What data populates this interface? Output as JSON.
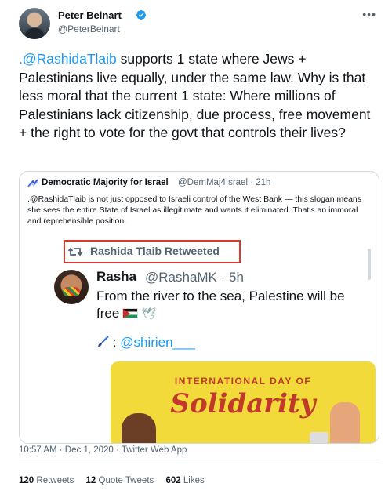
{
  "author": {
    "name": "Peter Beinart",
    "handle": "@PeterBeinart",
    "more": "•••"
  },
  "tweet": {
    "mention": ".@RashidaTlaib",
    "text": " supports 1 state where Jews + Palestinians live equally, under the same law. Why is that less moral that the current 1 state: Where millions of Palestinians lack citizenship, due process, free movement + the right to vote for the govt that controls their lives?"
  },
  "quote": {
    "name": "Democratic Majority for Israel",
    "meta": "@DemMaj4Israel · 21h",
    "text": ".@RashidaTlaib is not just opposed to Israeli control of the West Bank — this slogan means she sees the entire State of Israel as illegitimate and wants it eliminated. That's an immoral and reprehensible position.",
    "embed": {
      "retweet_label": "Rashida Tlaib Retweeted",
      "name": "Rasha",
      "handle": "@RashaMK · 5h",
      "text": "From the river to the sea, Palestine will be free",
      "credit_prefix": ":",
      "credit": "@shirien___",
      "poster_top": "INTERNATIONAL DAY OF",
      "poster_main": "Solidarity"
    }
  },
  "timestamp": "10:57 AM · Dec 1, 2020 · Twitter Web App",
  "stats": {
    "retweets_count": "120",
    "retweets_label": "Retweets",
    "quotes_count": "12",
    "quotes_label": "Quote Tweets",
    "likes_count": "602",
    "likes_label": "Likes"
  },
  "colors": {
    "link": "#1d9bf0",
    "highlight_box": "#d93a2b",
    "poster_bg": "#f2da3b"
  }
}
